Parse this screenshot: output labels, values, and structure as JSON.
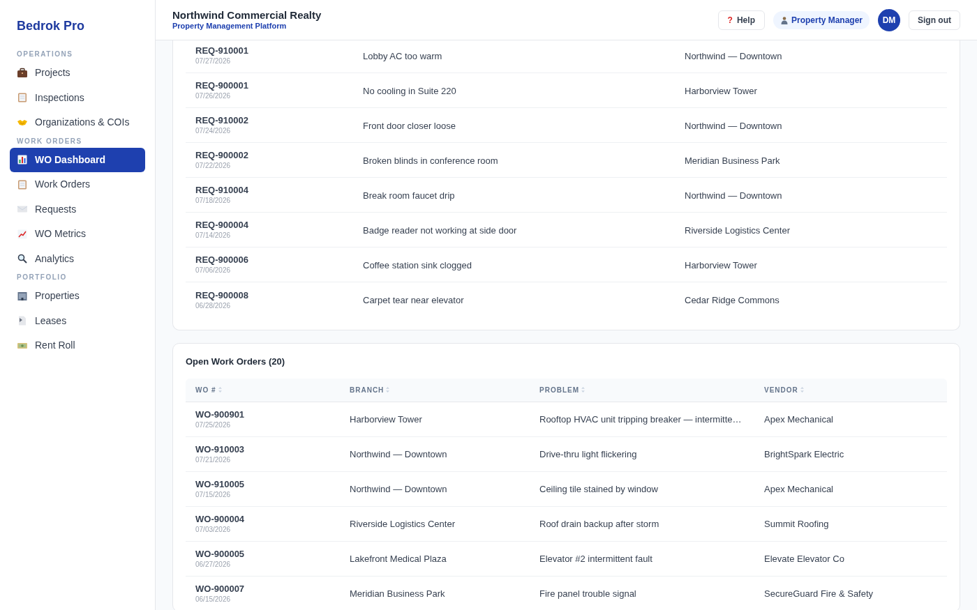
{
  "brand": "Bedrok Pro",
  "sidebar": {
    "sections": [
      {
        "label": "OPERATIONS",
        "items": [
          {
            "label": "Projects",
            "kind": "briefcase",
            "selected": false
          },
          {
            "label": "Inspections",
            "kind": "notepad",
            "selected": false
          },
          {
            "label": "Organizations & COIs",
            "kind": "handshake",
            "selected": false
          }
        ]
      },
      {
        "label": "WORK ORDERS",
        "items": [
          {
            "label": "WO Dashboard",
            "kind": "barchart",
            "selected": true
          },
          {
            "label": "Work Orders",
            "kind": "notepad",
            "selected": false
          },
          {
            "label": "Requests",
            "kind": "envelope",
            "selected": false
          },
          {
            "label": "WO Metrics",
            "kind": "linechart",
            "selected": false
          },
          {
            "label": "Analytics",
            "kind": "search",
            "selected": false
          }
        ]
      },
      {
        "label": "PORTFOLIO",
        "items": [
          {
            "label": "Properties",
            "kind": "building",
            "selected": false
          },
          {
            "label": "Leases",
            "kind": "document",
            "selected": false
          },
          {
            "label": "Rent Roll",
            "kind": "money",
            "selected": false
          }
        ]
      }
    ]
  },
  "header": {
    "title": "Northwind Commercial Realty",
    "subtitle": "Property Management Platform",
    "help": "Help",
    "help_icon": "?",
    "role": "Property Manager",
    "avatar": "DM",
    "sign_out": "Sign out"
  },
  "requests": {
    "rows": [
      {
        "id": "REQ-910001",
        "date": "07/27/2026",
        "description": "Lobby AC too warm",
        "location": "Northwind — Downtown"
      },
      {
        "id": "REQ-900001",
        "date": "07/26/2026",
        "description": "No cooling in Suite 220",
        "location": "Harborview Tower"
      },
      {
        "id": "REQ-910002",
        "date": "07/24/2026",
        "description": "Front door closer loose",
        "location": "Northwind — Downtown"
      },
      {
        "id": "REQ-900002",
        "date": "07/22/2026",
        "description": "Broken blinds in conference room",
        "location": "Meridian Business Park"
      },
      {
        "id": "REQ-910004",
        "date": "07/18/2026",
        "description": "Break room faucet drip",
        "location": "Northwind — Downtown"
      },
      {
        "id": "REQ-900004",
        "date": "07/14/2026",
        "description": "Badge reader not working at side door",
        "location": "Riverside Logistics Center"
      },
      {
        "id": "REQ-900006",
        "date": "07/06/2026",
        "description": "Coffee station sink clogged",
        "location": "Harborview Tower"
      },
      {
        "id": "REQ-900008",
        "date": "06/28/2026",
        "description": "Carpet tear near elevator",
        "location": "Cedar Ridge Commons"
      }
    ]
  },
  "open_work_orders": {
    "title": "Open Work Orders (20)",
    "columns": [
      "WO #",
      "BRANCH",
      "PROBLEM",
      "VENDOR"
    ],
    "rows": [
      {
        "id": "WO-900901",
        "date": "07/25/2026",
        "branch": "Harborview Tower",
        "problem": "Rooftop HVAC unit tripping breaker — intermitte…",
        "vendor": "Apex Mechanical"
      },
      {
        "id": "WO-910003",
        "date": "07/21/2026",
        "branch": "Northwind — Downtown",
        "problem": "Drive-thru light flickering",
        "vendor": "BrightSpark Electric"
      },
      {
        "id": "WO-910005",
        "date": "07/15/2026",
        "branch": "Northwind — Downtown",
        "problem": "Ceiling tile stained by window",
        "vendor": "Apex Mechanical"
      },
      {
        "id": "WO-900004",
        "date": "07/03/2026",
        "branch": "Riverside Logistics Center",
        "problem": "Roof drain backup after storm",
        "vendor": "Summit Roofing"
      },
      {
        "id": "WO-900005",
        "date": "06/27/2026",
        "branch": "Lakefront Medical Plaza",
        "problem": "Elevator #2 intermittent fault",
        "vendor": "Elevate Elevator Co"
      },
      {
        "id": "WO-900007",
        "date": "06/15/2026",
        "branch": "Meridian Business Park",
        "problem": "Fire panel trouble signal",
        "vendor": "SecureGuard Fire & Safety"
      }
    ]
  }
}
